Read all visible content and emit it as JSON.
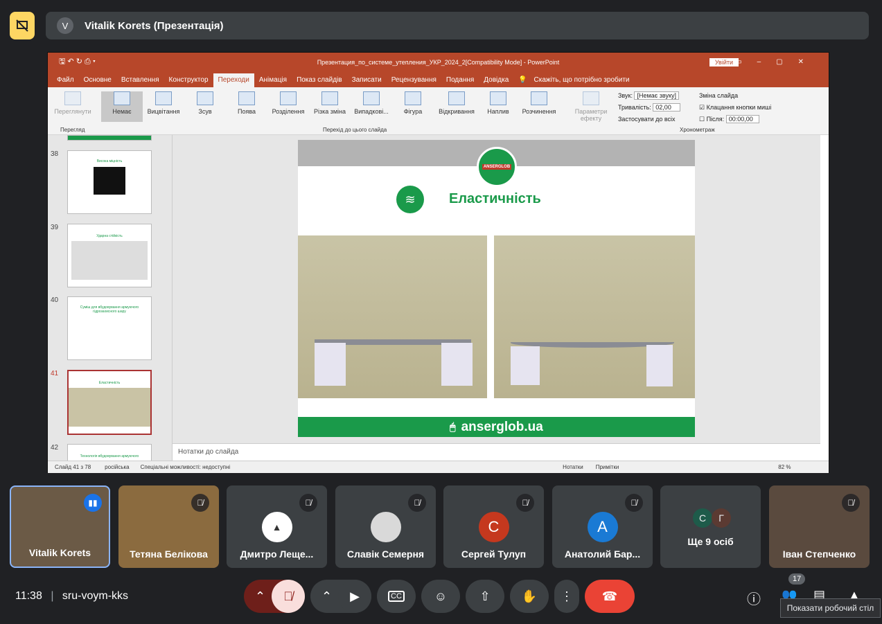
{
  "presenter": {
    "avatar_letter": "V",
    "title": "Vitalik Korets (Презентація)"
  },
  "ppt": {
    "window_title": "Презентация_по_системе_утепления_УКР_2024_2[Compatibility Mode]  -  PowerPoint",
    "signin": "Увійти",
    "tabs": [
      "Файл",
      "Основне",
      "Вставлення",
      "Конструктор",
      "Переходи",
      "Анімація",
      "Показ слайдів",
      "Записати",
      "Рецензування",
      "Подання",
      "Довідка"
    ],
    "tell_me": "Скажіть, що потрібно зробити",
    "preview": "Переглянути",
    "preview_group": "Перегляд",
    "transitions": [
      "Немає",
      "Вицвітання",
      "Зсув",
      "Поява",
      "Розділення",
      "Різка зміна",
      "Випадкові...",
      "Фігура",
      "Відкривання",
      "Наплив",
      "Розчинення"
    ],
    "transitions_group": "Перехід до цього слайда",
    "effect_params": "Параметри ефекту",
    "sound_label": "Звук:",
    "sound_value": "[Немає звуку]",
    "duration_label": "Тривалість:",
    "duration_value": "02,00",
    "apply_all": "Застосувати до всіх",
    "advance_label": "Зміна слайда",
    "on_click": "Клацання кнопки миші",
    "after_label": "Після:",
    "after_value": "00:00,00",
    "timing_group": "Хронометраж",
    "slide_nums": [
      "38",
      "39",
      "40",
      "41",
      "42"
    ],
    "thumb_titles": [
      "Висока міцність",
      "Ударна стійкість",
      "Суміш для вбудовування армуючого гідрозахисного шару",
      "Еластичність",
      "Технологія вбудовування армуючого"
    ],
    "slide_title": "Еластичність",
    "logo_text": "ANSERGLOB",
    "site": "anserglob.ua",
    "notes": "Нотатки до слайда",
    "status_slide": "Слайд 41 з 78",
    "status_lang": "російська",
    "status_access": "Спеціальні можливості: недоступні",
    "status_notes": "Нотатки",
    "status_comments": "Примітки",
    "zoom": "82 %"
  },
  "participants": [
    {
      "name": "Vitalik Korets"
    },
    {
      "name": "Тетяна Белікова"
    },
    {
      "name": "Дмитро Леще..."
    },
    {
      "name": "Славік Семерня"
    },
    {
      "name": "Сергей Тулуп",
      "letter": "С",
      "color": "#c5381e"
    },
    {
      "name": "Анатолий Бар...",
      "letter": "А",
      "color": "#1a7ad4"
    },
    {
      "name": "Ще 9 осіб",
      "l1": "С",
      "l2": "Г"
    },
    {
      "name": "Іван Степченко"
    }
  ],
  "bottom": {
    "time": "11:38",
    "code": "sru-voym-kks",
    "people_count": "17",
    "tooltip": "Показати робочий стіл"
  }
}
